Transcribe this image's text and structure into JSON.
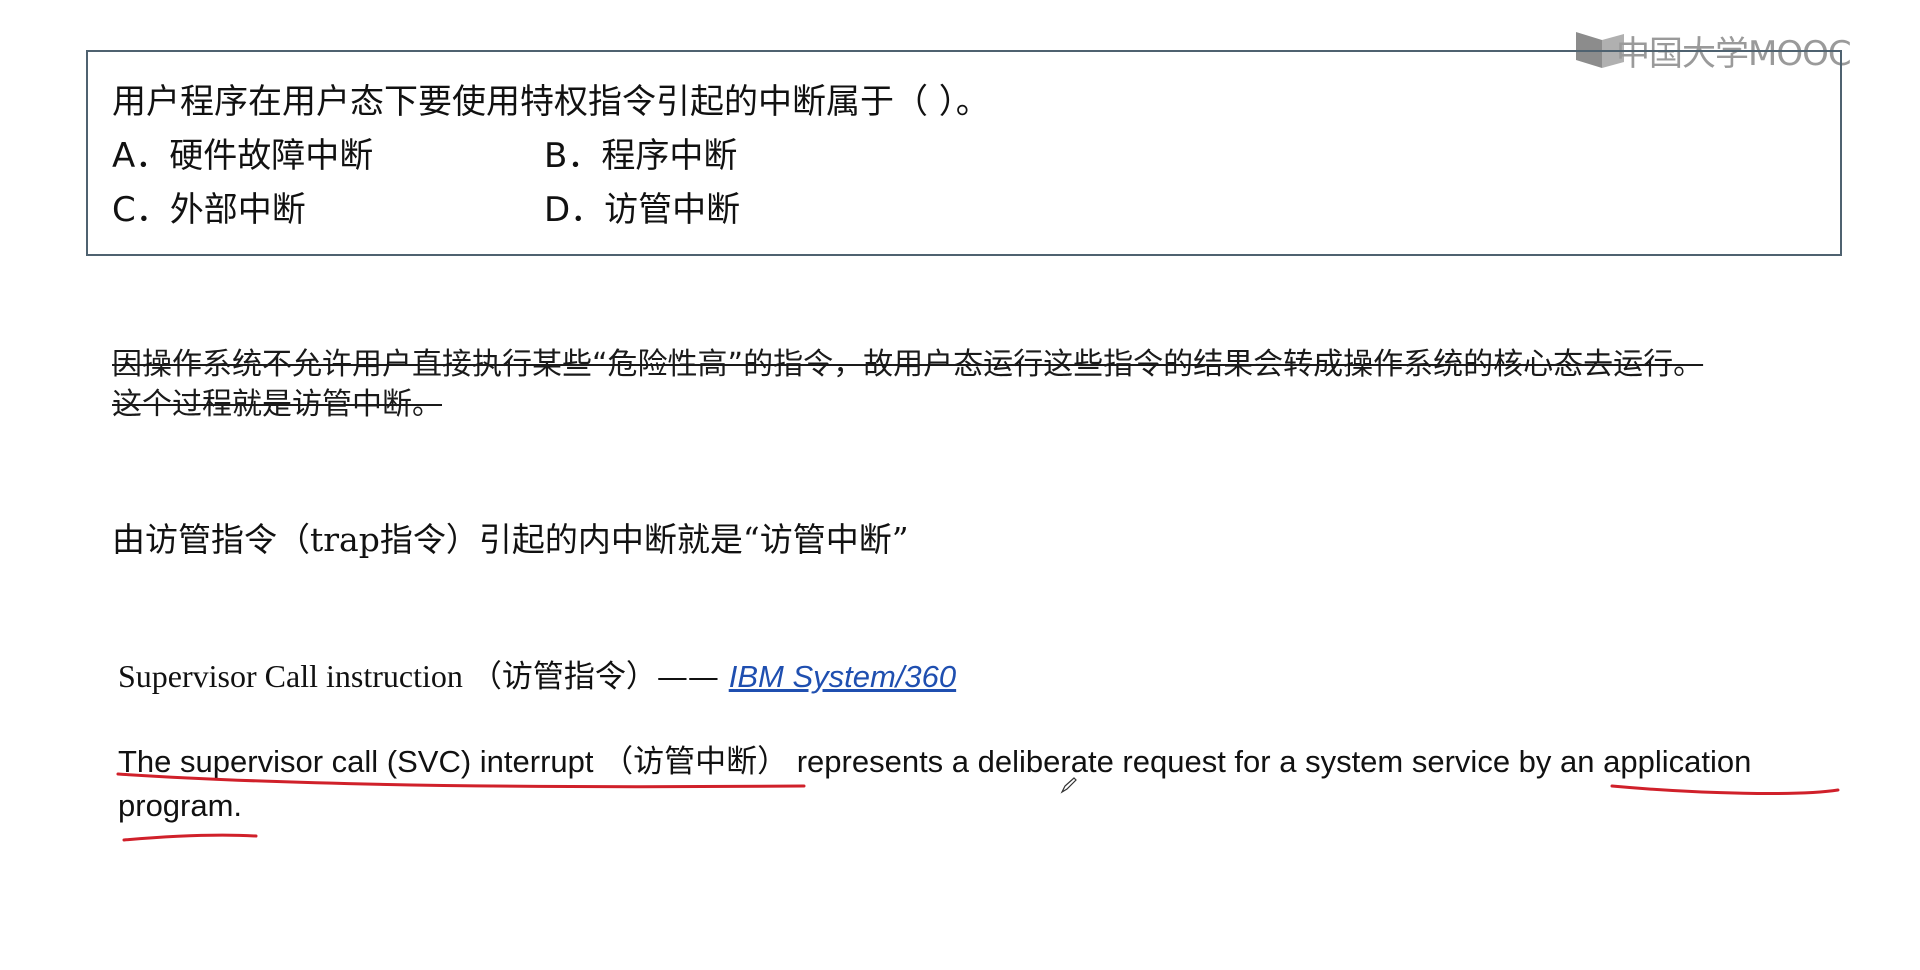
{
  "logo": {
    "text": "中国大学MOOC"
  },
  "question": {
    "stem": "用户程序在用户态下要使用特权指令引起的中断属于（   ）。",
    "options": [
      {
        "label": "A．硬件故障中断"
      },
      {
        "label": "B．程序中断"
      },
      {
        "label": "C．外部中断"
      },
      {
        "label": "D．访管中断"
      }
    ]
  },
  "struck_explanation": "因操作系统不允许用户直接执行某些“危险性高”的指令，故用户态运行这些指令的结果会转成操作系统的核心态去运行。这个过程就是访管中断。",
  "trap_note": "由访管指令（trap指令）引起的内中断就是“访管中断”",
  "svc": {
    "prefix": "Supervisor Call instruction ",
    "zh": "（访管指令）—— ",
    "link": "IBM System/360"
  },
  "definition": {
    "part1": "The supervisor call (SVC) interrupt ",
    "zh": "（访管中断）",
    "part2": " represents a deliberate request for a system service by an application program."
  },
  "colors": {
    "annotation": "#d0202a",
    "link": "#1f4fb0",
    "box_border": "#4f6270"
  }
}
